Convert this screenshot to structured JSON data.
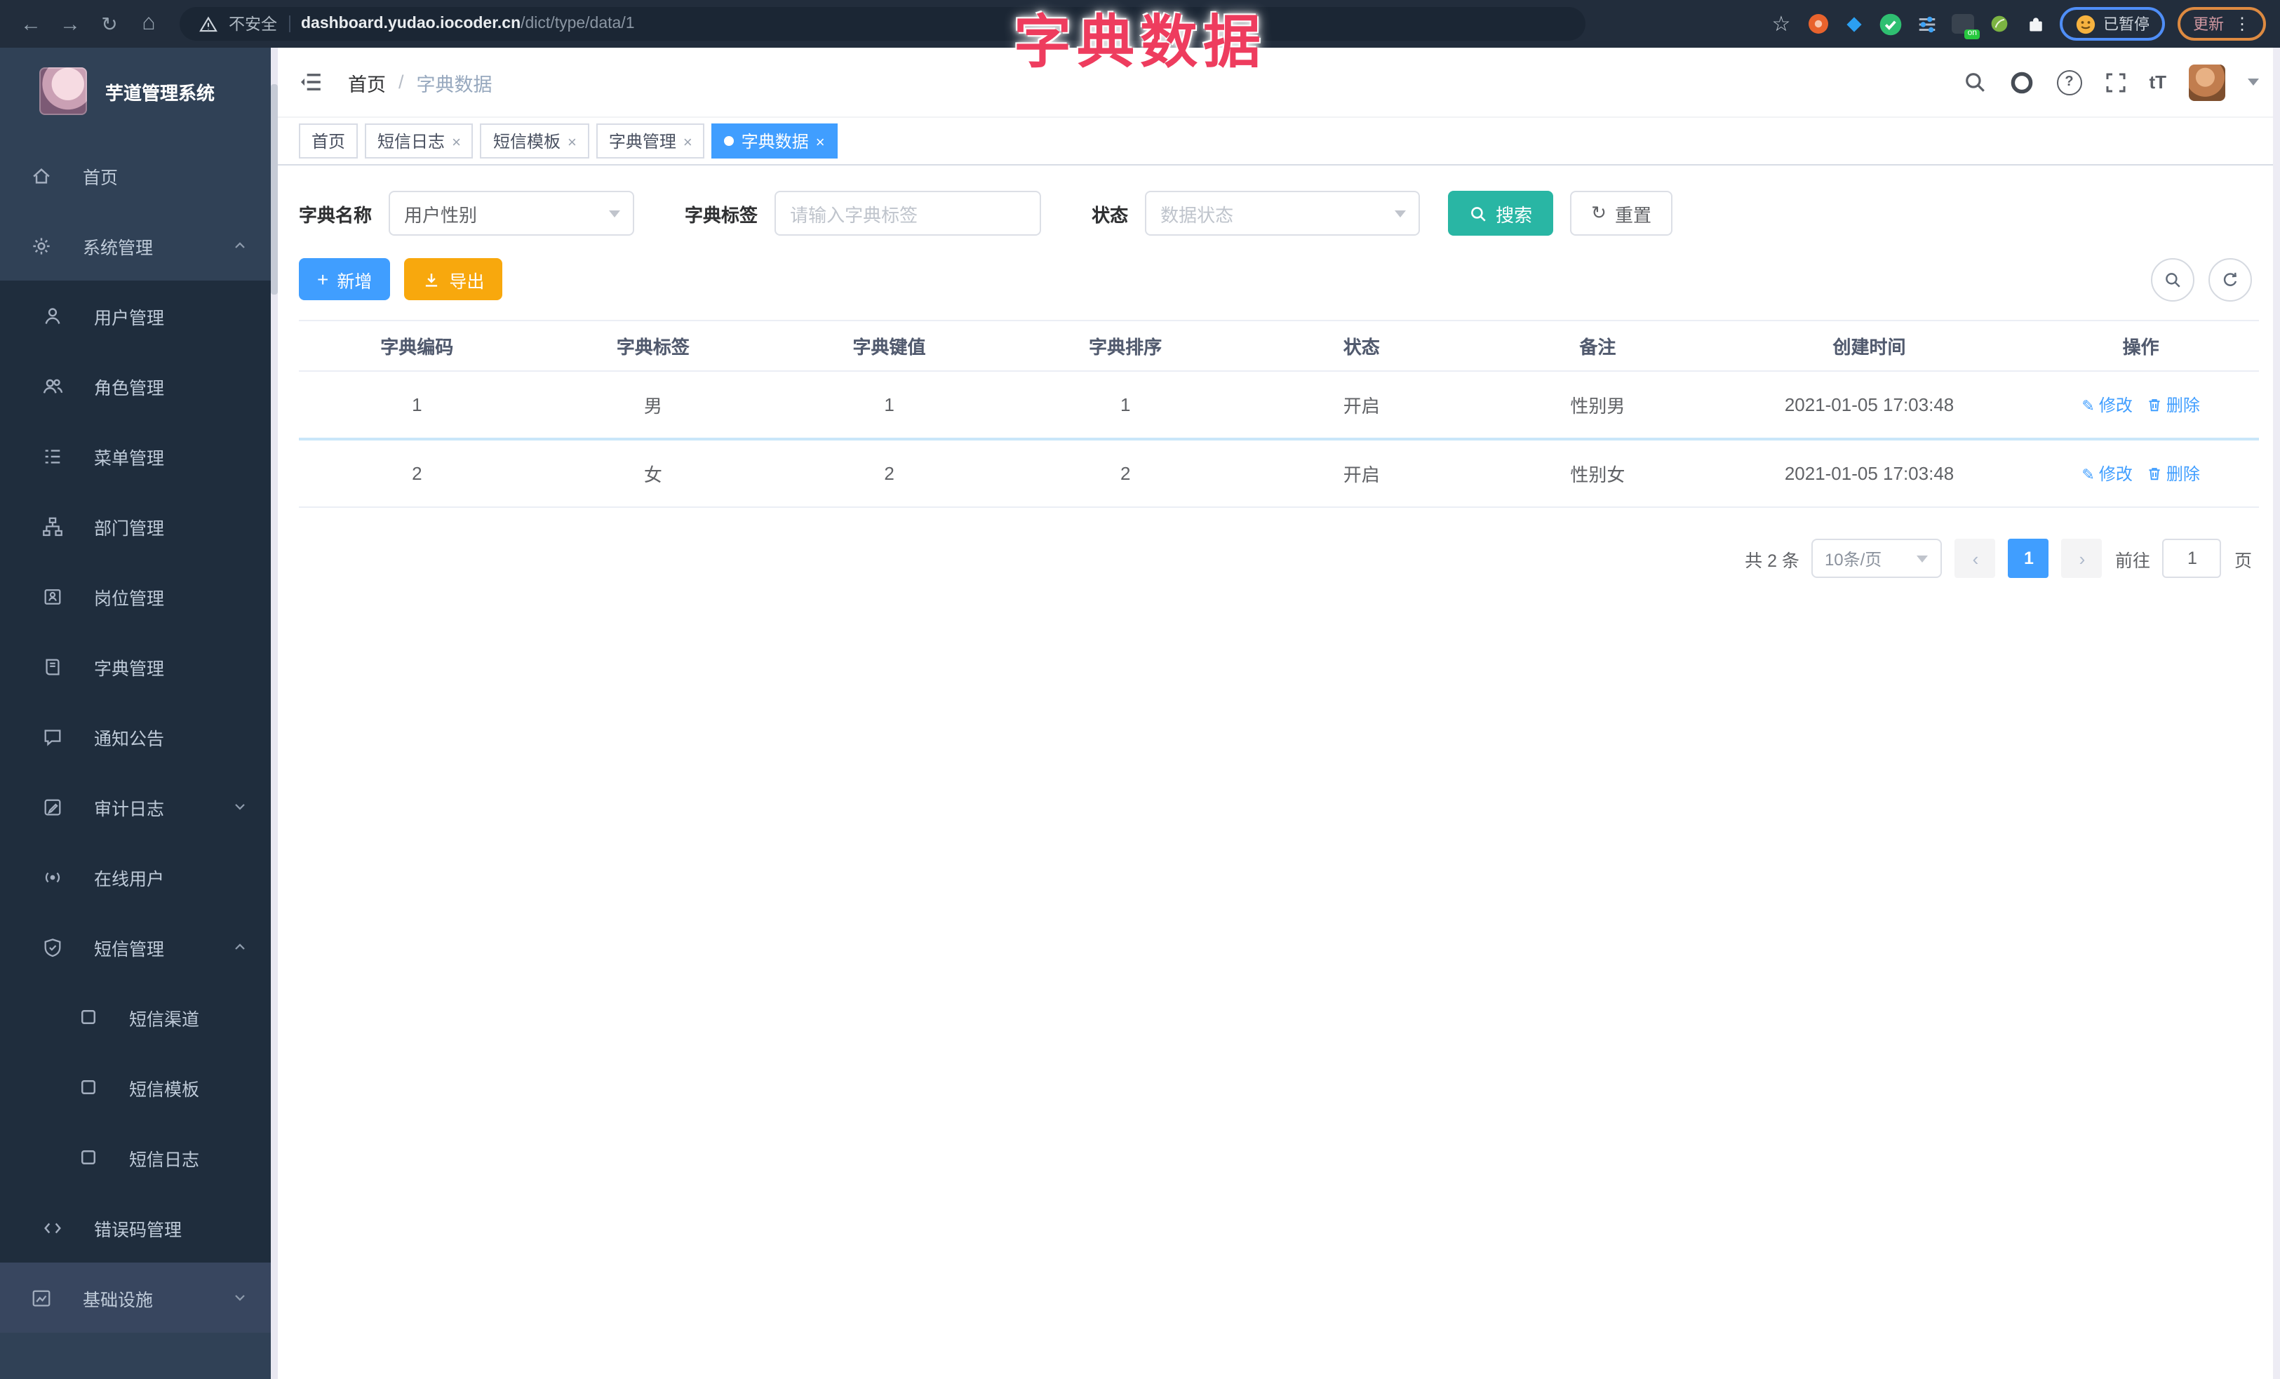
{
  "browser": {
    "security_label": "不安全",
    "url_domain": "dashboard.yudao.iocoder.cn",
    "url_path": "/dict/type/data/1",
    "on_badge": "on",
    "paused_label": "已暂停",
    "update_label": "更新",
    "toolbar_icons": [
      "back-icon",
      "forward-icon",
      "reload-icon",
      "home-icon",
      "warning-icon",
      "star-icon",
      "extension-icons",
      "emoji-avatar",
      "kebab-menu-icon"
    ]
  },
  "overlay": {
    "title": "字典数据",
    "color": "#ee3c5e"
  },
  "sidebar": {
    "app_title": "芋道管理系统",
    "items": [
      {
        "label": "首页",
        "icon": "home-icon"
      },
      {
        "label": "系统管理",
        "icon": "gear-icon",
        "expanded": true
      },
      {
        "label": "用户管理",
        "icon": "user-icon"
      },
      {
        "label": "角色管理",
        "icon": "users-icon"
      },
      {
        "label": "菜单管理",
        "icon": "menu-list-icon"
      },
      {
        "label": "部门管理",
        "icon": "org-tree-icon"
      },
      {
        "label": "岗位管理",
        "icon": "badge-icon"
      },
      {
        "label": "字典管理",
        "icon": "book-icon"
      },
      {
        "label": "通知公告",
        "icon": "comment-icon"
      },
      {
        "label": "审计日志",
        "icon": "clipboard-icon",
        "expanded": false
      },
      {
        "label": "在线用户",
        "icon": "broadcast-icon"
      },
      {
        "label": "短信管理",
        "icon": "shield-icon",
        "expanded": true
      },
      {
        "label": "短信渠道",
        "icon": "square-icon"
      },
      {
        "label": "短信模板",
        "icon": "square-icon"
      },
      {
        "label": "短信日志",
        "icon": "square-icon"
      },
      {
        "label": "错误码管理",
        "icon": "code-icon"
      },
      {
        "label": "基础设施",
        "icon": "chart-icon",
        "expanded": false
      }
    ],
    "colors": {
      "bg": "#304156",
      "submenu_bg": "#1f2d3d",
      "text": "#bfcbd9"
    }
  },
  "header": {
    "breadcrumb_home": "首页",
    "breadcrumb_sep": "/",
    "breadcrumb_current": "字典数据",
    "right_icons": [
      "search-icon",
      "github-icon",
      "help-icon",
      "fullscreen-icon",
      "font-size-icon",
      "avatar",
      "chevron-down-icon"
    ]
  },
  "tabs": [
    {
      "label": "首页",
      "closable": false,
      "active": false
    },
    {
      "label": "短信日志",
      "closable": true,
      "active": false
    },
    {
      "label": "短信模板",
      "closable": true,
      "active": false
    },
    {
      "label": "字典管理",
      "closable": true,
      "active": false
    },
    {
      "label": "字典数据",
      "closable": true,
      "active": true
    }
  ],
  "filters": {
    "dict_name_label": "字典名称",
    "dict_name_value": "用户性别",
    "dict_label_label": "字典标签",
    "dict_label_placeholder": "请输入字典标签",
    "status_label": "状态",
    "status_placeholder": "数据状态",
    "search_button": "搜索",
    "reset_button": "重置"
  },
  "toolbar": {
    "add_button": "新增",
    "export_button": "导出",
    "round_icons": [
      "search-icon",
      "refresh-icon"
    ]
  },
  "table": {
    "headers": [
      "字典编码",
      "字典标签",
      "字典键值",
      "字典排序",
      "状态",
      "备注",
      "创建时间",
      "操作"
    ],
    "rows": [
      {
        "code": "1",
        "label": "男",
        "value": "1",
        "sort": "1",
        "status": "开启",
        "remark": "性别男",
        "created": "2021-01-05 17:03:48"
      },
      {
        "code": "2",
        "label": "女",
        "value": "2",
        "sort": "2",
        "status": "开启",
        "remark": "性别女",
        "created": "2021-01-05 17:03:48"
      }
    ],
    "actions": {
      "edit": "修改",
      "delete": "删除"
    }
  },
  "pagination": {
    "total_text": "共 2 条",
    "page_size": "10条/页",
    "current_page": "1",
    "goto_label": "前往",
    "goto_value": "1",
    "unit": "页"
  },
  "colors": {
    "accent_blue": "#409eff",
    "search_teal": "#29b6a4",
    "export_amber": "#f8a80d",
    "sidebar_bg": "#304156",
    "browser_bar_bg": "#222d3c"
  }
}
